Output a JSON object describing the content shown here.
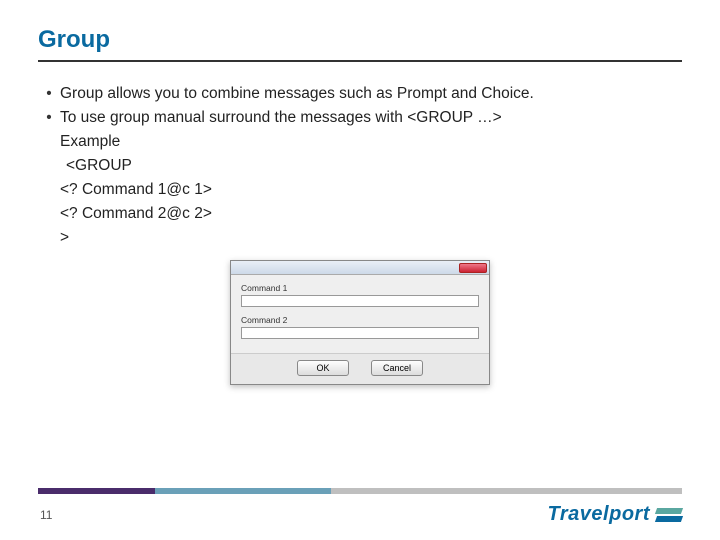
{
  "title": "Group",
  "bullets": {
    "b1": "Group allows you to combine messages such as Prompt and Choice.",
    "b2": "To use group manual surround the messages with <GROUP …>",
    "ex_label": "Example",
    "l1": "<GROUP",
    "l2": "<? Command 1@c 1>",
    "l3": "<? Command 2@c 2>",
    "l4": ">"
  },
  "dialog": {
    "label1": "Command 1",
    "label2": "Command 2",
    "ok": "OK",
    "cancel": "Cancel"
  },
  "page_number": "11",
  "brand": "Travelport"
}
